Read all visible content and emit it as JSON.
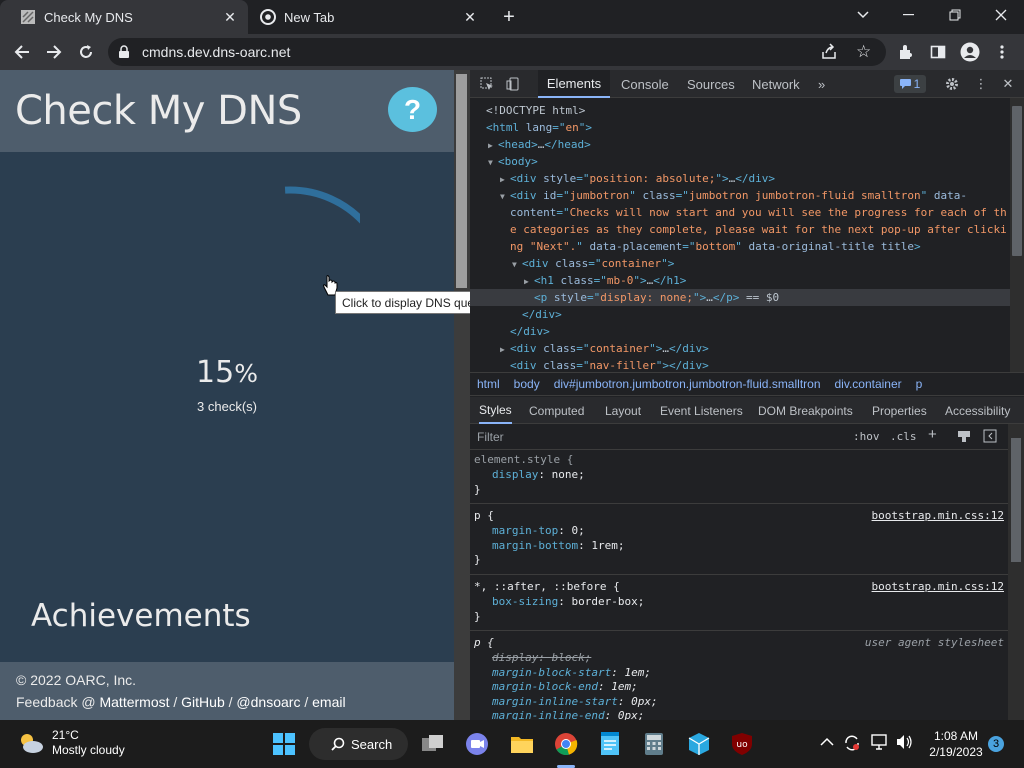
{
  "tabs": [
    {
      "title": "Check My DNS",
      "active": true
    },
    {
      "title": "New Tab",
      "active": false
    }
  ],
  "address": {
    "url": "cmdns.dev.dns-oarc.net"
  },
  "page": {
    "title": "Check My DNS",
    "help_label": "?",
    "progress_value": "15",
    "progress_unit": "%",
    "checks_label": "3 check(s)",
    "achievements_title": "Achievements",
    "copyright": "© 2022 OARC, Inc.",
    "feedback_prefix": "Feedback @",
    "feedback_links": [
      "Mattermost",
      "GitHub",
      "@dnsoarc",
      "email"
    ],
    "feedback_sep": "/",
    "tooltip": "Click to display DNS query/responses for all checks",
    "progress_fraction": 0.15
  },
  "devtools": {
    "tabs": [
      "Elements",
      "Console",
      "Sources",
      "Network"
    ],
    "more_label": "»",
    "issues_count": "1",
    "dom_lines": [
      {
        "indent": 0,
        "arrow": "",
        "parts": [
          [
            "tx",
            "<!DOCTYPE html>"
          ]
        ]
      },
      {
        "indent": 0,
        "arrow": "",
        "parts": [
          [
            "tg",
            "<html "
          ],
          [
            "at",
            "lang"
          ],
          [
            "tg",
            "=\""
          ],
          [
            "av",
            "en"
          ],
          [
            "tg",
            "\">"
          ]
        ]
      },
      {
        "indent": 1,
        "arrow": "▶",
        "parts": [
          [
            "tg",
            "<head>"
          ],
          [
            "tx",
            "…"
          ],
          [
            "tg",
            "</head>"
          ]
        ]
      },
      {
        "indent": 1,
        "arrow": "▼",
        "parts": [
          [
            "tg",
            "<body>"
          ]
        ]
      },
      {
        "indent": 2,
        "arrow": "▶",
        "parts": [
          [
            "tg",
            "<div "
          ],
          [
            "at",
            "style"
          ],
          [
            "tg",
            "=\""
          ],
          [
            "av",
            "position: absolute;"
          ],
          [
            "tg",
            "\">"
          ],
          [
            "tx",
            "…"
          ],
          [
            "tg",
            "</div>"
          ]
        ]
      },
      {
        "indent": 2,
        "arrow": "▼",
        "parts": [
          [
            "tg",
            "<div "
          ],
          [
            "at",
            "id"
          ],
          [
            "tg",
            "=\""
          ],
          [
            "av",
            "jumbotron"
          ],
          [
            "tg",
            "\" "
          ],
          [
            "at",
            "class"
          ],
          [
            "tg",
            "=\""
          ],
          [
            "av",
            "jumbotron jumbotron-fluid smalltron"
          ],
          [
            "tg",
            "\" "
          ],
          [
            "at",
            "data-"
          ]
        ]
      },
      {
        "indent": 2,
        "arrow": "",
        "parts": [
          [
            "at",
            "content"
          ],
          [
            "tg",
            "=\""
          ],
          [
            "av",
            "Checks will now start and you will see the progress for each of th"
          ]
        ]
      },
      {
        "indent": 2,
        "arrow": "",
        "parts": [
          [
            "av",
            "e categories as they complete, please wait for the next pop-up after clicki"
          ]
        ]
      },
      {
        "indent": 2,
        "arrow": "",
        "parts": [
          [
            "av",
            "ng \"Next\"."
          ],
          [
            "tg",
            "\" "
          ],
          [
            "at",
            "data-placement"
          ],
          [
            "tg",
            "=\""
          ],
          [
            "av",
            "bottom"
          ],
          [
            "tg",
            "\" "
          ],
          [
            "at",
            "data-original-title"
          ],
          [
            "tg",
            " "
          ],
          [
            "at",
            "title"
          ],
          [
            "tg",
            ">"
          ]
        ]
      },
      {
        "indent": 3,
        "arrow": "▼",
        "parts": [
          [
            "tg",
            "<div "
          ],
          [
            "at",
            "class"
          ],
          [
            "tg",
            "=\""
          ],
          [
            "av",
            "container"
          ],
          [
            "tg",
            "\">"
          ]
        ]
      },
      {
        "indent": 4,
        "arrow": "▶",
        "parts": [
          [
            "tg",
            "<h1 "
          ],
          [
            "at",
            "class"
          ],
          [
            "tg",
            "=\""
          ],
          [
            "av",
            "mb-0"
          ],
          [
            "tg",
            "\">"
          ],
          [
            "tx",
            "…"
          ],
          [
            "tg",
            "</h1>"
          ]
        ]
      },
      {
        "indent": 4,
        "arrow": "",
        "selected": true,
        "parts": [
          [
            "tg",
            "<p "
          ],
          [
            "at",
            "style"
          ],
          [
            "tg",
            "=\""
          ],
          [
            "av",
            "display: none;"
          ],
          [
            "tg",
            "\">"
          ],
          [
            "tx",
            "…"
          ],
          [
            "tg",
            "</p>"
          ],
          [
            "tx",
            " == $0"
          ]
        ]
      },
      {
        "indent": 3,
        "arrow": "",
        "parts": [
          [
            "tg",
            "</div>"
          ]
        ]
      },
      {
        "indent": 2,
        "arrow": "",
        "parts": [
          [
            "tg",
            "</div>"
          ]
        ]
      },
      {
        "indent": 2,
        "arrow": "▶",
        "parts": [
          [
            "tg",
            "<div "
          ],
          [
            "at",
            "class"
          ],
          [
            "tg",
            "=\""
          ],
          [
            "av",
            "container"
          ],
          [
            "tg",
            "\">"
          ],
          [
            "tx",
            "…"
          ],
          [
            "tg",
            "</div>"
          ]
        ]
      },
      {
        "indent": 2,
        "arrow": "",
        "parts": [
          [
            "tg",
            "<div "
          ],
          [
            "at",
            "class"
          ],
          [
            "tg",
            "=\""
          ],
          [
            "av",
            "nav-filler"
          ],
          [
            "tg",
            "\">"
          ],
          [
            "tg",
            "</div>"
          ]
        ]
      }
    ],
    "breadcrumbs": [
      "html",
      "body",
      "div#jumbotron.jumbotron.jumbotron-fluid.smalltron",
      "div.container",
      "p"
    ],
    "style_tabs": [
      "Styles",
      "Computed",
      "Layout",
      "Event Listeners",
      "DOM Breakpoints",
      "Properties",
      "Accessibility"
    ],
    "filter_placeholder": "Filter",
    "hov_label": ":hov",
    "cls_label": ".cls",
    "rules": [
      {
        "selector": "element.style {",
        "source": "",
        "props": [
          [
            "display",
            "none;"
          ]
        ]
      },
      {
        "selector": "p {",
        "source": "bootstrap.min.css:12",
        "props": [
          [
            "margin-top",
            "0;"
          ],
          [
            "margin-bottom",
            "1rem;"
          ]
        ]
      },
      {
        "selector": "*, ::after, ::before {",
        "source": "bootstrap.min.css:12",
        "props": [
          [
            "box-sizing",
            "border-box;"
          ]
        ]
      },
      {
        "selector": "p {",
        "source": "user agent stylesheet",
        "ua": true,
        "props": [
          [
            "display",
            "block;"
          ],
          [
            "margin-block-start",
            "1em;"
          ],
          [
            "margin-block-end",
            "1em;"
          ],
          [
            "margin-inline-start",
            "0px;"
          ],
          [
            "margin-inline-end",
            "0px;"
          ]
        ]
      }
    ]
  },
  "taskbar": {
    "temp": "21°C",
    "condition": "Mostly cloudy",
    "search_label": "Search",
    "time": "1:08 AM",
    "date": "2/19/2023",
    "notifications": "3"
  },
  "colors": {
    "page_bg": "#2b3e50",
    "page_header": "#4e5d6c",
    "help": "#5bc0de",
    "spinner": "#2f6f9c",
    "accent": "#8ab4f8"
  }
}
